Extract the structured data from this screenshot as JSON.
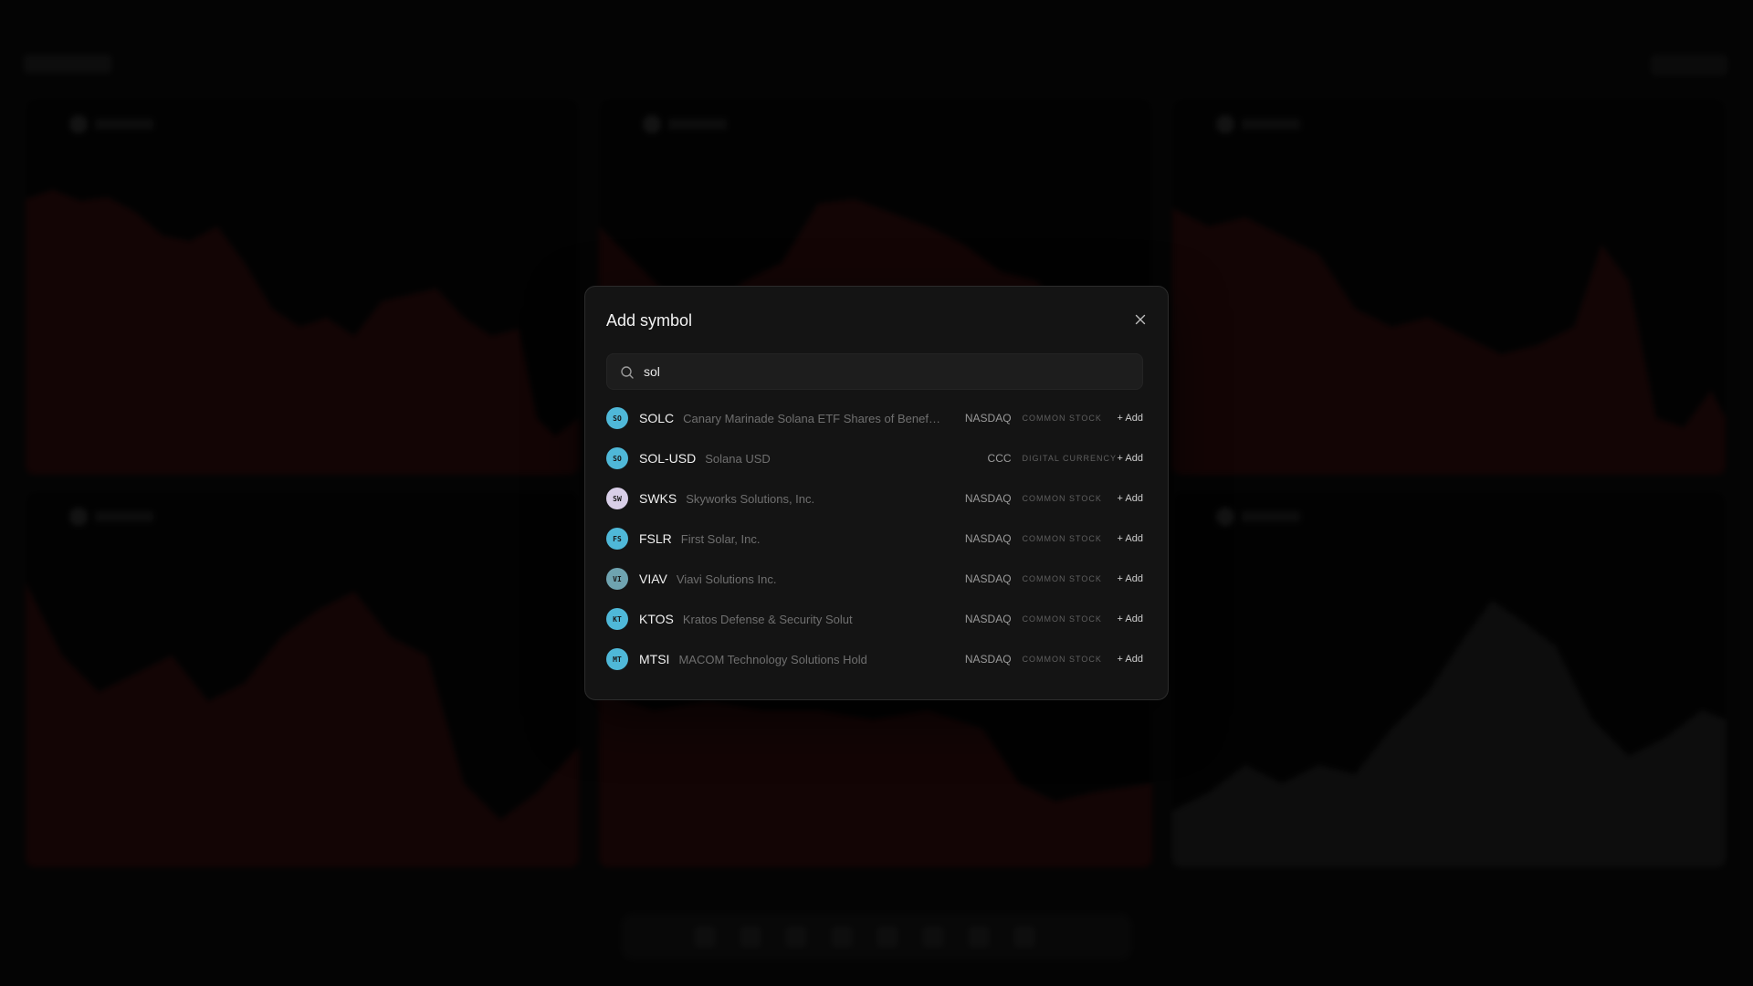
{
  "modal": {
    "title": "Add symbol",
    "search": {
      "value": "sol",
      "placeholder": ""
    },
    "results": [
      {
        "initials": "SO",
        "ticker": "SOLC",
        "name": "Canary Marinade Solana ETF Shares of Benefi...",
        "exchange": "NASDAQ",
        "kind": "COMMON STOCK",
        "add": "+ Add",
        "color": "#4fb8d8"
      },
      {
        "initials": "SO",
        "ticker": "SOL-USD",
        "name": "Solana USD",
        "exchange": "CCC",
        "kind": "DIGITAL CURRENCY",
        "add": "+ Add",
        "color": "#4fb8d8"
      },
      {
        "initials": "SW",
        "ticker": "SWKS",
        "name": "Skyworks Solutions, Inc.",
        "exchange": "NASDAQ",
        "kind": "COMMON STOCK",
        "add": "+ Add",
        "color": "#d9cfe8"
      },
      {
        "initials": "FS",
        "ticker": "FSLR",
        "name": "First Solar, Inc.",
        "exchange": "NASDAQ",
        "kind": "COMMON STOCK",
        "add": "+ Add",
        "color": "#4fb8d8"
      },
      {
        "initials": "VI",
        "ticker": "VIAV",
        "name": "Viavi Solutions Inc.",
        "exchange": "NASDAQ",
        "kind": "COMMON STOCK",
        "add": "+ Add",
        "color": "#6fa3b0"
      },
      {
        "initials": "KT",
        "ticker": "KTOS",
        "name": "Kratos Defense & Security Solut",
        "exchange": "NASDAQ",
        "kind": "COMMON STOCK",
        "add": "+ Add",
        "color": "#4fb8d8"
      },
      {
        "initials": "MT",
        "ticker": "MTSI",
        "name": "MACOM Technology Solutions Hold",
        "exchange": "NASDAQ",
        "kind": "COMMON STOCK",
        "add": "+ Add",
        "color": "#4fb8d8"
      }
    ]
  },
  "colors": {
    "accent": "#4fb8d8",
    "background_chart_down": "#3a0f0f",
    "background_chart_neutral": "#262626"
  },
  "icons": {
    "close": "close-icon",
    "search": "search-icon"
  }
}
